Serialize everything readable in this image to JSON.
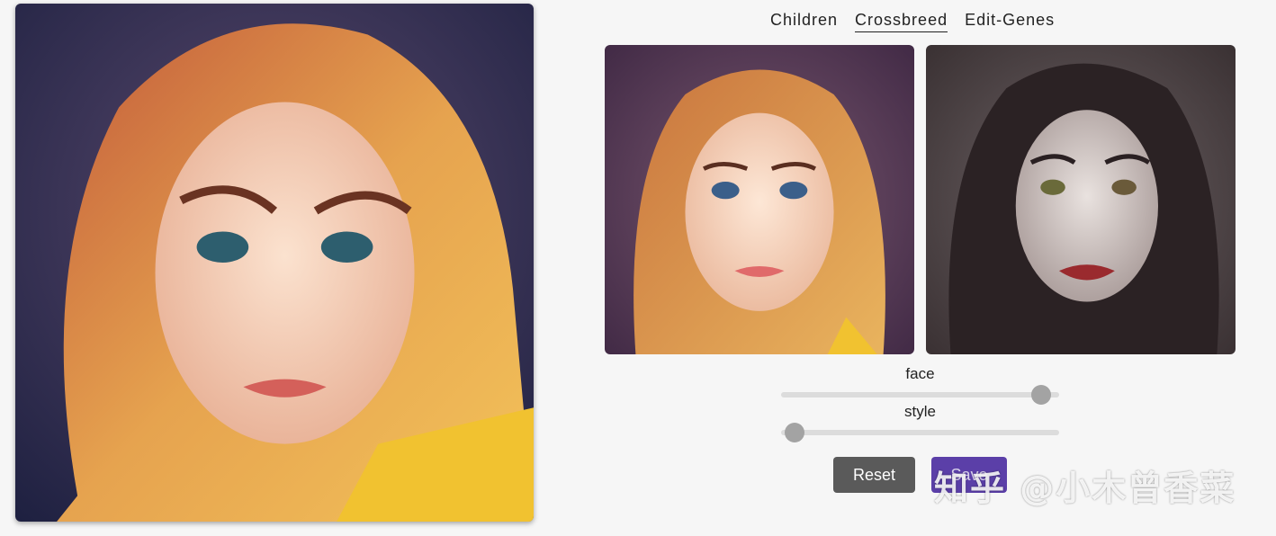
{
  "tabs": [
    {
      "label": "Children",
      "active": false
    },
    {
      "label": "Crossbreed",
      "active": true
    },
    {
      "label": "Edit-Genes",
      "active": false
    }
  ],
  "sliders": {
    "face": {
      "label": "face",
      "value": 0.935
    },
    "style": {
      "label": "style",
      "value": 0.05
    }
  },
  "buttons": {
    "reset_label": "Reset",
    "save_label": "Save"
  },
  "watermark": "知乎 @小木曾香菜",
  "colors": {
    "button_reset": "#5a5a5a",
    "button_save": "#5b3fa8",
    "slider_track": "#dcdcdc",
    "slider_thumb": "#a3a3a3",
    "background": "#f6f6f6"
  }
}
